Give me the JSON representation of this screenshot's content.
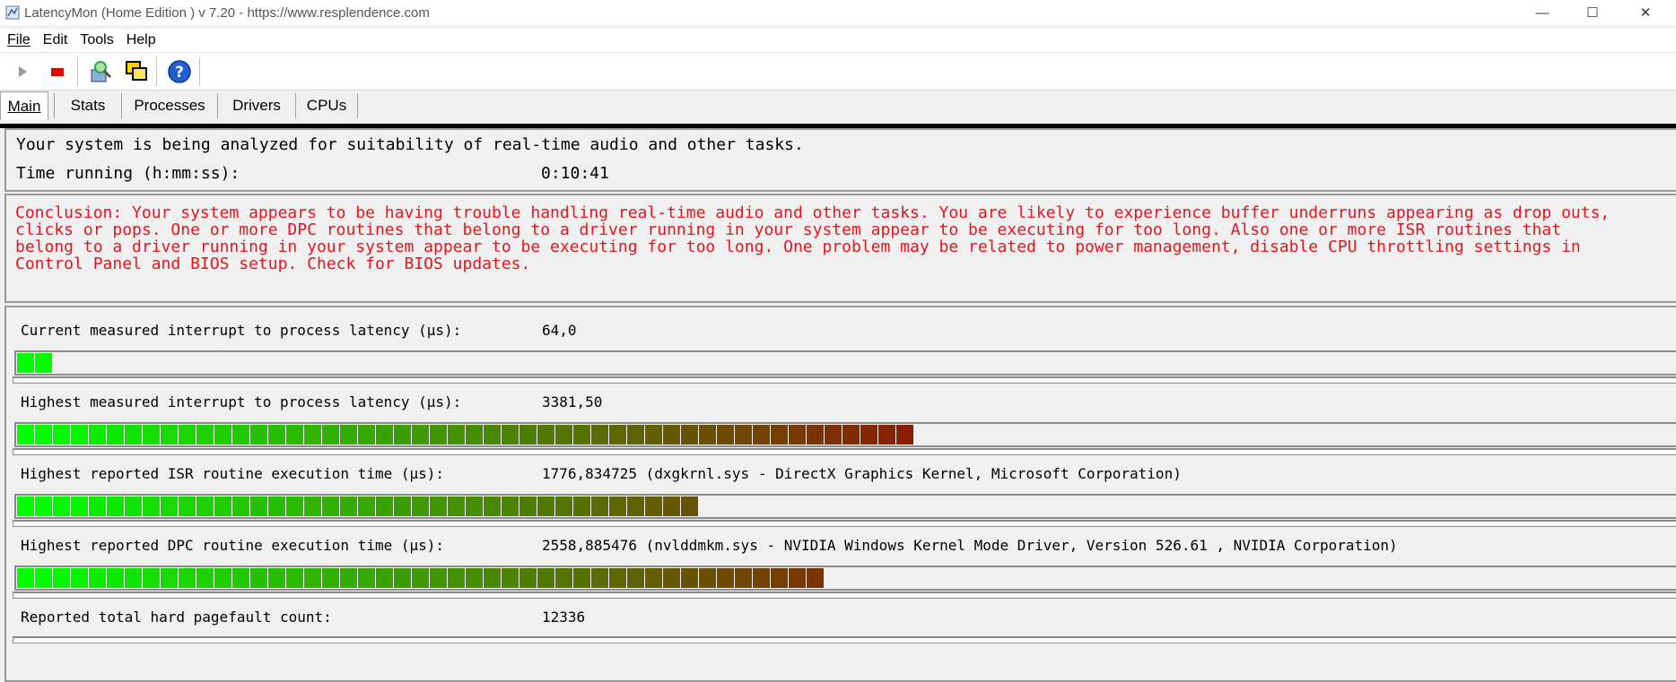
{
  "window": {
    "title": "LatencyMon  (Home Edition )  v 7.20 - https://www.resplendence.com",
    "min_glyph": "—",
    "max_glyph": "☐",
    "close_glyph": "✕"
  },
  "menu": [
    "File",
    "Edit",
    "Tools",
    "Help"
  ],
  "toolbar": {
    "buttons": [
      "play-icon",
      "stop-icon",
      "search-tool-icon",
      "windows-icon",
      "help-icon"
    ]
  },
  "tabs": [
    "Main",
    "Stats",
    "Processes",
    "Drivers",
    "CPUs"
  ],
  "status": {
    "analyzing": "Your system is being analyzed for suitability of real-time audio and other tasks.",
    "time_label": "Time running (h:mm:ss):",
    "time_value": "0:10:41"
  },
  "conclusion": "Conclusion: Your system appears to be having trouble handling real-time audio and other tasks. You are likely to experience buffer underruns appearing as drop outs,\nclicks or pops. One or more DPC routines that belong to a driver running in your system appear to be executing for too long. Also one or more ISR routines that\nbelong to a driver running in your system appear to be executing for too long. One problem may be related to power management, disable CPU throttling settings in\nControl Panel and BIOS setup. Check for BIOS updates.",
  "metrics": [
    {
      "label": "Current measured interrupt to process latency (µs):",
      "value": "64,0",
      "level": 0.02
    },
    {
      "label": "Highest measured interrupt to process latency (µs):",
      "value": "3381,50",
      "level": 0.54
    },
    {
      "label": "Highest reported ISR routine execution time (µs):",
      "value": "1776,834725  (dxgkrnl.sys - DirectX Graphics Kernel, Microsoft Corporation)",
      "level": 0.41
    },
    {
      "label": "Highest reported DPC routine execution time (µs):",
      "value": "2558,885476  (nvlddmkm.sys - NVIDIA Windows Kernel Mode Driver, Version 526.61 , NVIDIA Corporation)",
      "level": 0.49
    },
    {
      "label": "Reported total hard pagefault count:",
      "value": "12336",
      "level": 0
    }
  ],
  "colors": {
    "bar_start": "#00ff00",
    "bar_end": "#8b1a00",
    "conclusion_text": "#e8141c"
  }
}
